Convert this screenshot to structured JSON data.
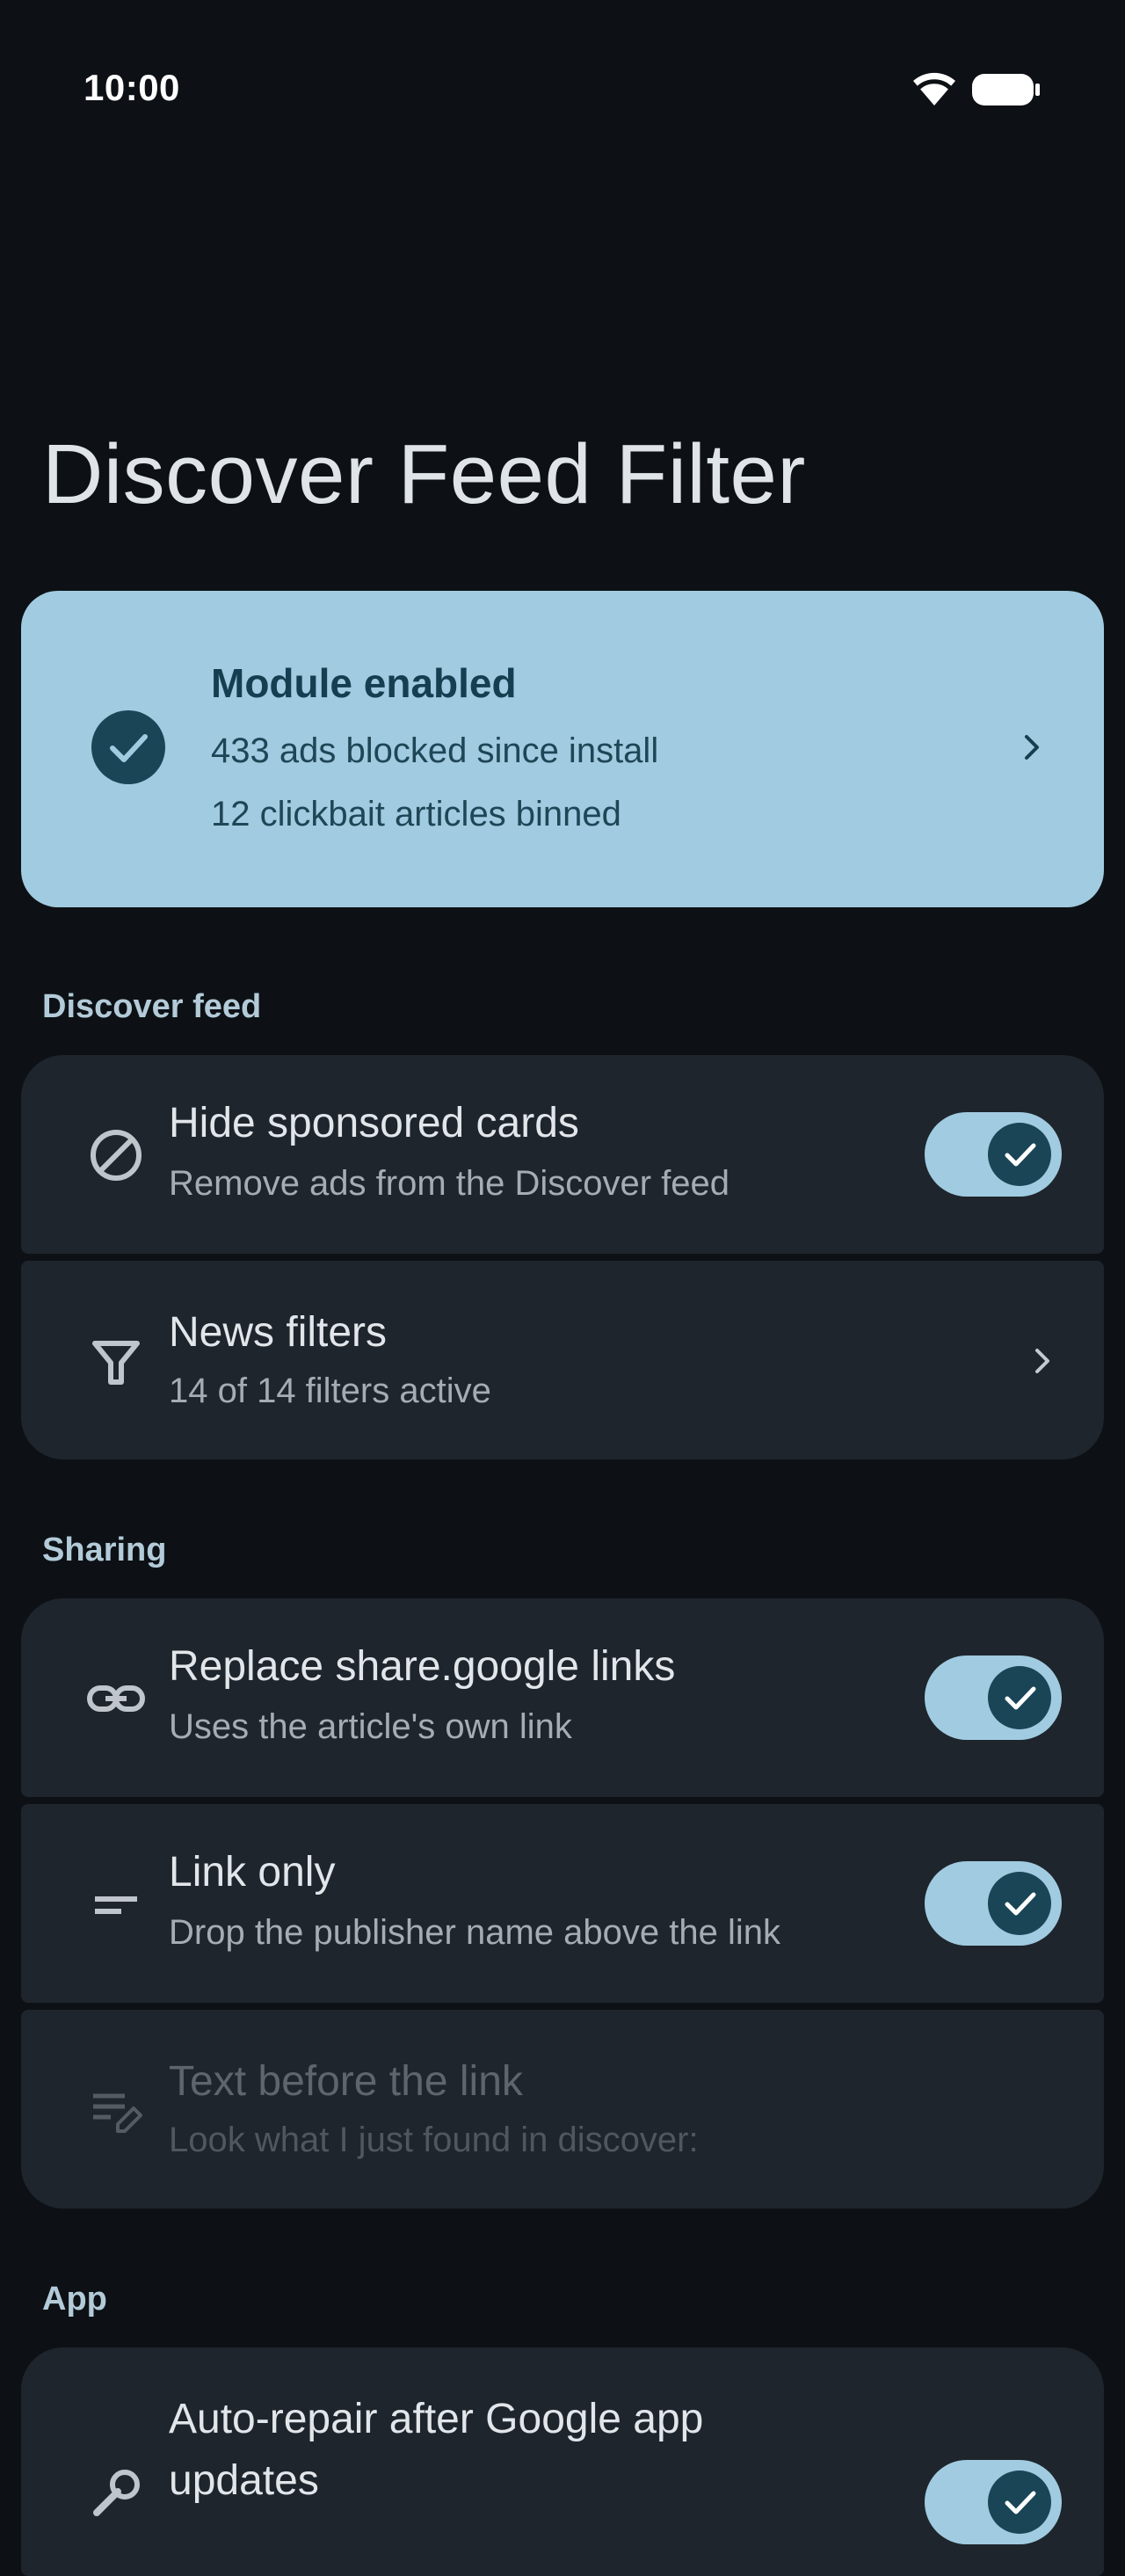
{
  "status_bar": {
    "time": "10:00"
  },
  "page": {
    "title": "Discover Feed Filter"
  },
  "module_card": {
    "title": "Module enabled",
    "line1": "433 ads blocked since install",
    "line2": "12 clickbait articles binned"
  },
  "sections": {
    "discover": {
      "header": "Discover feed",
      "hide_sponsored": {
        "title": "Hide sponsored cards",
        "subtitle": "Remove ads from the Discover feed",
        "checked": true
      },
      "news_filters": {
        "title": "News filters",
        "subtitle": "14 of 14 filters active"
      }
    },
    "sharing": {
      "header": "Sharing",
      "replace_links": {
        "title": "Replace share.google links",
        "subtitle": "Uses the article's own link",
        "checked": true
      },
      "link_only": {
        "title": "Link only",
        "subtitle": "Drop the publisher name above the link",
        "checked": true
      },
      "text_before": {
        "title": "Text before the link",
        "subtitle": "Look what I just found in discover:",
        "enabled": false
      }
    },
    "app": {
      "header": "App",
      "auto_repair": {
        "title_line1": "Auto-repair after Google app",
        "title_line2": "updates",
        "checked": true
      }
    }
  },
  "colors": {
    "background": "#0d1115",
    "accent": "#a1cbe0",
    "accent_dark": "#1a4557",
    "row_background": "#1e252c"
  },
  "icons": {
    "status": [
      "wifi-icon",
      "battery-icon"
    ],
    "module": "check-circle-icon",
    "hide_sponsored": "block-icon",
    "news_filters": "filter-icon",
    "replace_links": "link-icon",
    "link_only": "short-text-icon",
    "text_before": "edit-note-icon",
    "chevron": "chevron-right-icon"
  }
}
